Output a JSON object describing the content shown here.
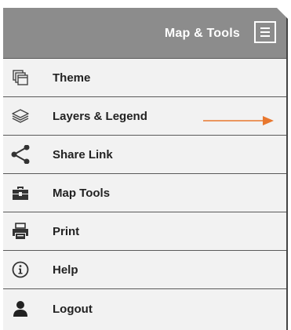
{
  "header": {
    "title": "Map & Tools",
    "menu_icon": "hamburger-menu-icon"
  },
  "menu": {
    "items": [
      {
        "label": "Theme",
        "icon": "theme-icon"
      },
      {
        "label": "Layers & Legend",
        "icon": "layers-icon"
      },
      {
        "label": "Share Link",
        "icon": "share-icon"
      },
      {
        "label": "Map Tools",
        "icon": "toolbox-icon"
      },
      {
        "label": "Print",
        "icon": "printer-icon"
      },
      {
        "label": "Help",
        "icon": "info-icon"
      },
      {
        "label": "Logout",
        "icon": "user-icon"
      }
    ]
  },
  "annotation": {
    "arrow_color": "#e8772e",
    "points_to": "Layers & Legend"
  },
  "colors": {
    "header_bg": "#8c8c8c",
    "panel_bg": "#f2f2f2",
    "divider": "#5a5a5a",
    "accent": "#e8772e"
  }
}
